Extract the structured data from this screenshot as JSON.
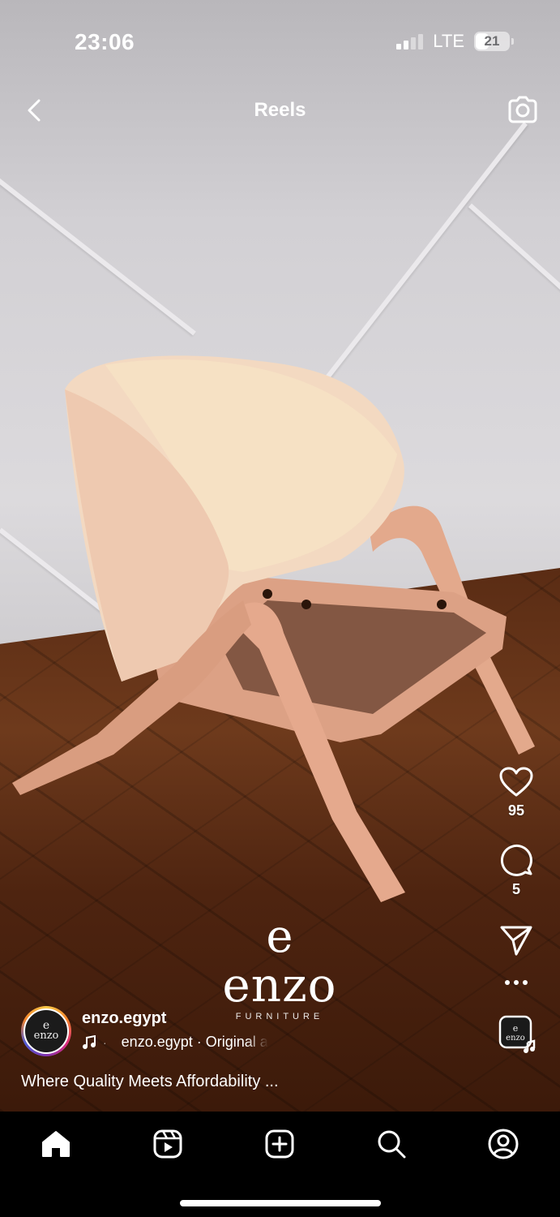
{
  "status_bar": {
    "time": "23:06",
    "network": "LTE",
    "battery": "21"
  },
  "header": {
    "title": "Reels"
  },
  "actions": {
    "likes": "95",
    "comments": "5"
  },
  "watermark": {
    "mark": "e",
    "word": "enzo",
    "subtitle": "FURNITURE"
  },
  "author": {
    "username": "enzo.egypt",
    "avatar_text": "enzo",
    "audio": "enzo.egypt · Original a"
  },
  "caption": "Where Quality Meets Affordability ...",
  "colors": {
    "nav_background": "#000000",
    "avatar_ring": "#dd2a7b"
  },
  "bottom_nav": {
    "items": [
      "home-icon",
      "reels-icon",
      "create-icon",
      "search-icon",
      "profile-icon"
    ]
  }
}
